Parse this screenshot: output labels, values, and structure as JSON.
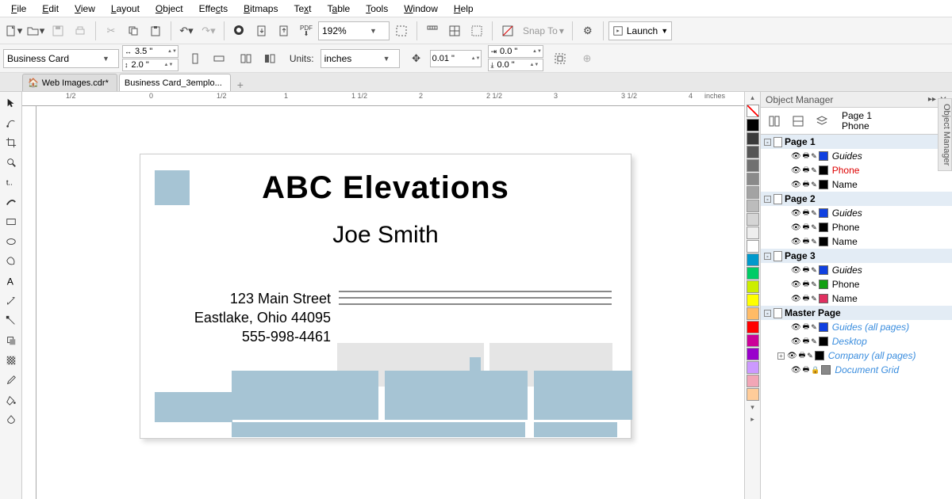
{
  "menu": [
    "File",
    "Edit",
    "View",
    "Layout",
    "Object",
    "Effects",
    "Bitmaps",
    "Text",
    "Table",
    "Tools",
    "Window",
    "Help"
  ],
  "toolbar1": {
    "zoom": "192%",
    "launch": "Launch",
    "snap": "Snap To"
  },
  "propbar": {
    "preset": "Business Card",
    "width": "3.5 \"",
    "height": "2.0 \"",
    "units_label": "Units:",
    "units": "inches",
    "nudge": "0.01 \"",
    "dup_x": "0.0 \"",
    "dup_y": "0.0 \""
  },
  "tabs": [
    {
      "label": "Web Images.cdr*",
      "active": false
    },
    {
      "label": "Business Card_3emplo...",
      "active": true
    }
  ],
  "ruler_h": [
    "1/2",
    "0",
    "1/2",
    "1",
    "1 1/2",
    "2",
    "2 1/2",
    "3",
    "3 1/2",
    "4"
  ],
  "ruler_unit": "inches",
  "card": {
    "company": "ABC Elevations",
    "name": "Joe Smith",
    "street": "123 Main Street",
    "citystate": "Eastlake, Ohio 44095",
    "phone": "555-998-4461"
  },
  "panel": {
    "title": "Object Manager",
    "current_page": "Page 1",
    "current_layer": "Phone",
    "pages": [
      {
        "name": "Page 1",
        "exp": "-",
        "layers": [
          {
            "name": "Guides",
            "color": "#1040e0",
            "italic": true,
            "red": false
          },
          {
            "name": "Phone",
            "color": "#000000",
            "italic": false,
            "red": true
          },
          {
            "name": "Name",
            "color": "#000000",
            "italic": false,
            "red": false
          }
        ]
      },
      {
        "name": "Page 2",
        "exp": "-",
        "layers": [
          {
            "name": "Guides",
            "color": "#1040e0",
            "italic": true,
            "red": false
          },
          {
            "name": "Phone",
            "color": "#000000",
            "italic": false,
            "red": false
          },
          {
            "name": "Name",
            "color": "#000000",
            "italic": false,
            "red": false
          }
        ]
      },
      {
        "name": "Page 3",
        "exp": "-",
        "layers": [
          {
            "name": "Guides",
            "color": "#1040e0",
            "italic": true,
            "red": false
          },
          {
            "name": "Phone",
            "color": "#12a012",
            "italic": false,
            "red": false
          },
          {
            "name": "Name",
            "color": "#e03060",
            "italic": false,
            "red": false
          }
        ]
      }
    ],
    "master": {
      "name": "Master Page",
      "layers": [
        {
          "name": "Guides (all pages)",
          "color": "#1040e0",
          "italic": true,
          "link": true
        },
        {
          "name": "Desktop",
          "color": "#000000",
          "italic": true,
          "link": true
        },
        {
          "name": "Company (all pages)",
          "color": "#000000",
          "italic": true,
          "link": true,
          "exp": "+"
        },
        {
          "name": "Document Grid",
          "color": "#888888",
          "italic": true,
          "link": true,
          "lock": true
        }
      ]
    }
  },
  "side_tab": "Object Manager",
  "palette": [
    "#000000",
    "#3a3a3a",
    "#555555",
    "#707070",
    "#8a8a8a",
    "#a3a3a3",
    "#bcbcbc",
    "#d5d5d5",
    "#eeeeee",
    "#ffffff",
    "#0099cc",
    "#00cc66",
    "#ccee00",
    "#ffff00",
    "#ffbb66",
    "#ff0000",
    "#cc0099",
    "#9900cc",
    "#cc99ff",
    "#f2a6b6",
    "#ffcc99"
  ]
}
